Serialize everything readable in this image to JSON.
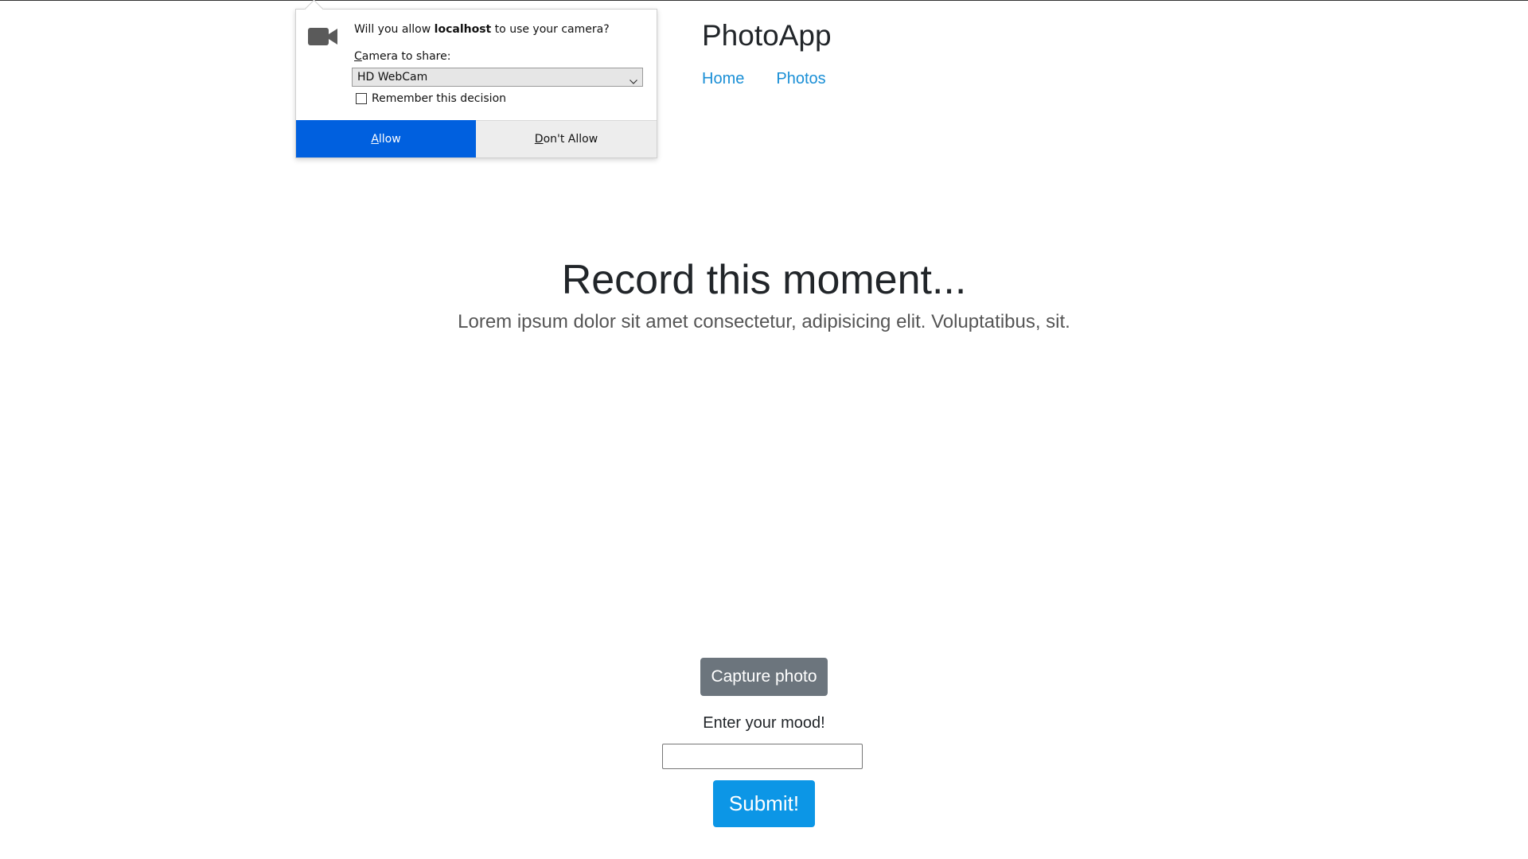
{
  "header": {
    "brand": "PhotoApp",
    "nav": [
      "Home",
      "Photos"
    ]
  },
  "hero": {
    "title": "Record this moment...",
    "subtitle": "Lorem ipsum dolor sit amet consectetur, adipisicing elit. Voluptatibus, sit."
  },
  "controls": {
    "capture_label": "Capture photo",
    "mood_label": "Enter your mood!",
    "mood_value": "",
    "submit_label": "Submit!"
  },
  "permission_popup": {
    "question_prefix": "Will you allow ",
    "host": "localhost",
    "question_suffix": " to use your camera?",
    "camera_label_accesskey": "C",
    "camera_label_rest": "amera to share:",
    "camera_selected": "HD WebCam",
    "remember_label": "Remember this decision",
    "remember_checked": false,
    "allow_accesskey": "A",
    "allow_rest": "llow",
    "dont_accesskey": "D",
    "dont_rest": "on't Allow",
    "icon": "camera-icon"
  },
  "colors": {
    "link": "#1a8fd6",
    "capture_button": "#6c757d",
    "submit_button": "#0c96e6",
    "allow_button": "#0060df"
  }
}
